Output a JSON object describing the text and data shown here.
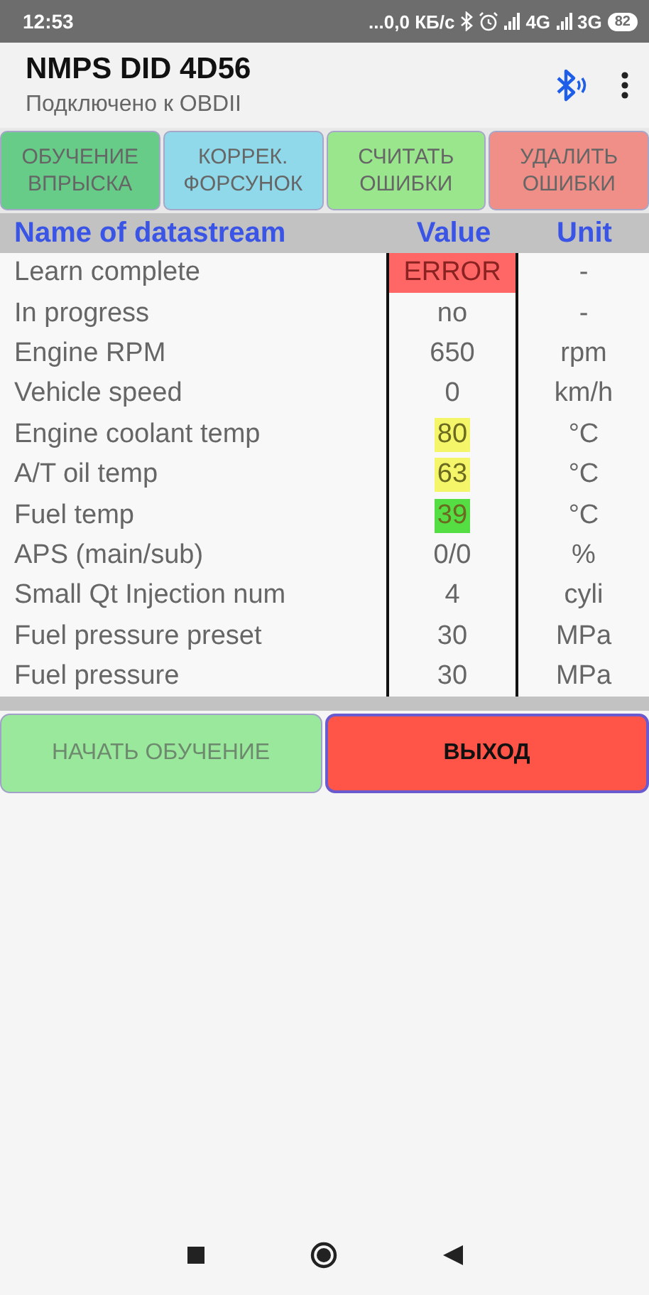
{
  "status_bar": {
    "time": "12:53",
    "speed": "...0,0 КБ/с",
    "network_1": "4G",
    "network_2": "3G",
    "battery": "82"
  },
  "app_bar": {
    "title": "NMPS DID 4D56",
    "subtitle": "Подключено к OBDII"
  },
  "top_buttons": [
    {
      "label": "ОБУЧЕНИЕ\nВПРЫСКА",
      "color": "#66cc88"
    },
    {
      "label": "КОРРЕК.\nФОРСУНОК",
      "color": "#8fd9ea"
    },
    {
      "label": "СЧИТАТЬ\nОШИБКИ",
      "color": "#99e68c"
    },
    {
      "label": "УДАЛИТЬ\nОШИБКИ",
      "color": "#ef8f87"
    }
  ],
  "table": {
    "columns": [
      "Name of datastream",
      "Value",
      "Unit"
    ],
    "rows": [
      {
        "name": "Learn complete",
        "value": "ERROR",
        "unit": "-",
        "color": "#ff6666",
        "kind": "cell"
      },
      {
        "name": "In progress",
        "value": "no",
        "unit": "-"
      },
      {
        "name": "Engine RPM",
        "value": "650",
        "unit": "rpm"
      },
      {
        "name": "Vehicle speed",
        "value": "0",
        "unit": "km/h"
      },
      {
        "name": "Engine coolant temp",
        "value": "80",
        "unit": "°C",
        "color": "#f5f56a",
        "kind": "text"
      },
      {
        "name": "A/T oil temp",
        "value": "63",
        "unit": "°C",
        "color": "#f5f56a",
        "kind": "text"
      },
      {
        "name": "Fuel temp",
        "value": "39",
        "unit": "°C",
        "color": "#55dd44",
        "kind": "text"
      },
      {
        "name": "APS (main/sub)",
        "value": "0/0",
        "unit": "%"
      },
      {
        "name": "Small Qt Injection num",
        "value": "4",
        "unit": "cyli"
      },
      {
        "name": "Fuel pressure preset",
        "value": "30",
        "unit": "MPa"
      },
      {
        "name": "Fuel pressure",
        "value": "30",
        "unit": "MPa"
      }
    ]
  },
  "bottom_buttons": [
    {
      "label": "НАЧАТЬ ОБУЧЕНИЕ",
      "color": "#99e89b",
      "disabled": true
    },
    {
      "label": "ВЫХОД",
      "color": "#ff5549",
      "disabled": false
    }
  ]
}
